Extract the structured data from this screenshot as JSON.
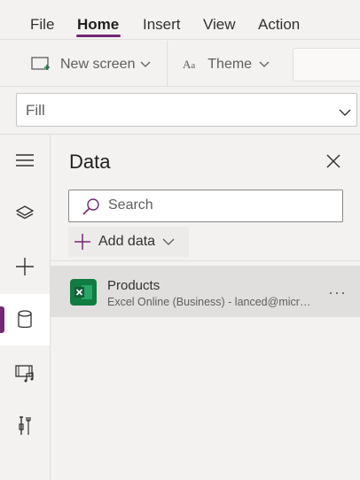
{
  "menu": {
    "items": [
      {
        "label": "File",
        "active": false
      },
      {
        "label": "Home",
        "active": true
      },
      {
        "label": "Insert",
        "active": false
      },
      {
        "label": "View",
        "active": false
      },
      {
        "label": "Action",
        "active": false
      }
    ]
  },
  "toolbar": {
    "new_screen_label": "New screen",
    "theme_label": "Theme"
  },
  "formula": {
    "property_value": "Fill"
  },
  "rail": {
    "items": [
      {
        "icon": "hamburger-menu-icon",
        "active": false
      },
      {
        "icon": "layers-icon",
        "active": false
      },
      {
        "icon": "plus-icon",
        "active": false
      },
      {
        "icon": "database-icon",
        "active": true
      },
      {
        "icon": "media-icon",
        "active": false
      },
      {
        "icon": "tools-icon",
        "active": false
      }
    ]
  },
  "panel": {
    "title": "Data",
    "search": {
      "placeholder": "Search",
      "value": ""
    },
    "add_data_label": "Add data",
    "sources": [
      {
        "name": "Products",
        "description": "Excel Online (Business) - lanced@micro...",
        "icon": "excel-icon"
      }
    ]
  },
  "colors": {
    "accent": "#742774",
    "excel": "#107c41",
    "background": "#f3f2f1",
    "selected_row": "#e1dfdd"
  }
}
